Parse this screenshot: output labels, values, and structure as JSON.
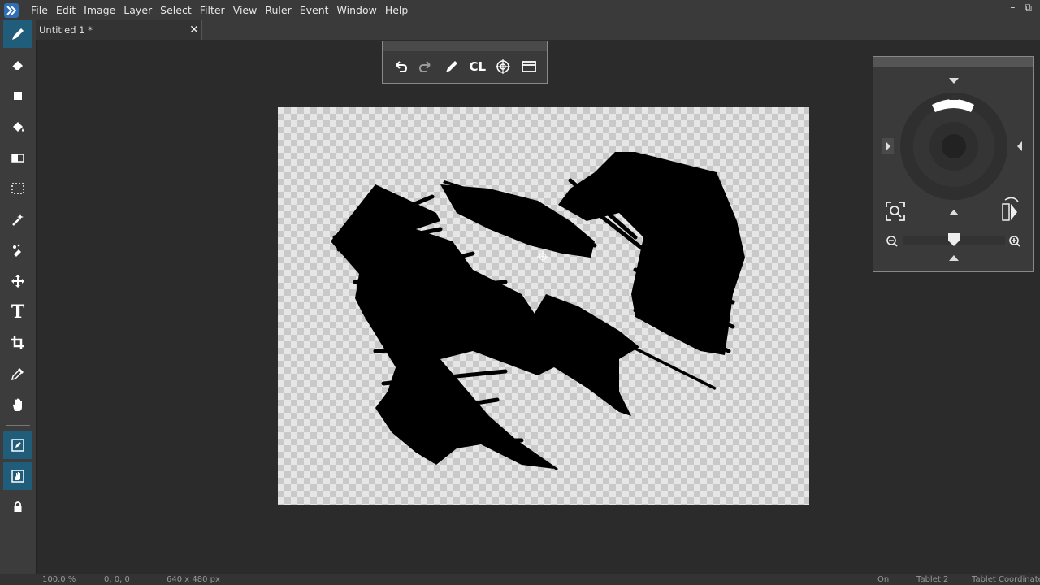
{
  "menubar": {
    "items": [
      "File",
      "Edit",
      "Image",
      "Layer",
      "Select",
      "Filter",
      "View",
      "Ruler",
      "Event",
      "Window",
      "Help"
    ]
  },
  "window_controls": {
    "minimize": "–",
    "restore": "⧉"
  },
  "tabs": [
    {
      "title": "Untitled 1 *",
      "close": "✕"
    }
  ],
  "tools": [
    "pencil-tool",
    "eraser-tool",
    "rectangle-tool",
    "fill-tool",
    "gradient-tool",
    "rect-select-tool",
    "magic-wand-tool",
    "select-brush-tool",
    "move-tool",
    "text-tool",
    "crop-tool",
    "eyedropper-tool",
    "hand-tool",
    "tablet-pen-toggle",
    "tablet-hand-toggle",
    "lock-tool"
  ],
  "text_tool_label": "T",
  "float_toolbar": {
    "buttons": [
      "undo-icon",
      "redo-icon",
      "pen-icon",
      "clear-icon",
      "target-icon",
      "window-icon"
    ],
    "clear_label": "CL"
  },
  "status": {
    "zoom": "100.0 %",
    "position": "0, 0, 0",
    "size": "640 x 480 px",
    "on": "On",
    "tablet": "Tablet 2",
    "tablet_coord": "Tablet Coordinates"
  },
  "colors": {
    "accent": "#1f5d7a",
    "ink": "#000000",
    "bg": "#2b2b2b",
    "panel": "#3a3a3a"
  }
}
